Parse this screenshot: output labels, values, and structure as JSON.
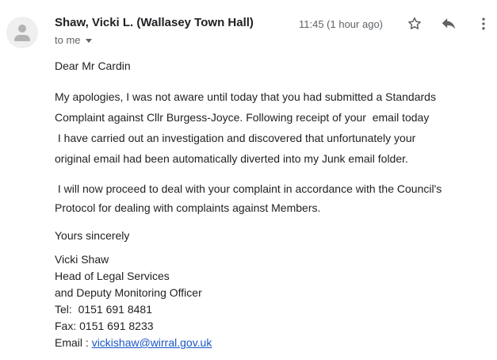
{
  "header": {
    "sender_name": "Shaw, Vicki L. (Wallasey Town Hall)",
    "recipient_label": "to me",
    "timestamp": "11:45 (1 hour ago)",
    "icons": {
      "avatar": "person-icon",
      "star": "star-icon",
      "reply": "reply-icon",
      "more": "more-vert-icon"
    }
  },
  "message": {
    "greeting": "Dear Mr Cardin",
    "paragraph1": [
      "My apologies, I was not aware until today that you had submitted a Standards",
      "Complaint against Cllr Burgess-Joyce. Following receipt of your  email today",
      " I have carried out an investigation and discovered that unfortunately your",
      "original email had been automatically diverted into my Junk email folder."
    ],
    "paragraph2": [
      " I will now proceed to deal with your complaint in accordance with the Council's",
      "Protocol for dealing with complaints against Members."
    ],
    "closing": "Yours sincerely",
    "signature": {
      "name": "Vicki Shaw",
      "title1": "Head of Legal Services",
      "title2": "and Deputy Monitoring Officer",
      "tel": "Tel:  0151 691 8481",
      "fax": "Fax: 0151 691 8233",
      "email_label": "Email : ",
      "email": "vickishaw@wirral.gov.uk"
    }
  },
  "colors": {
    "link": "#1a56c6",
    "text": "#222222",
    "muted": "#5f6368"
  }
}
